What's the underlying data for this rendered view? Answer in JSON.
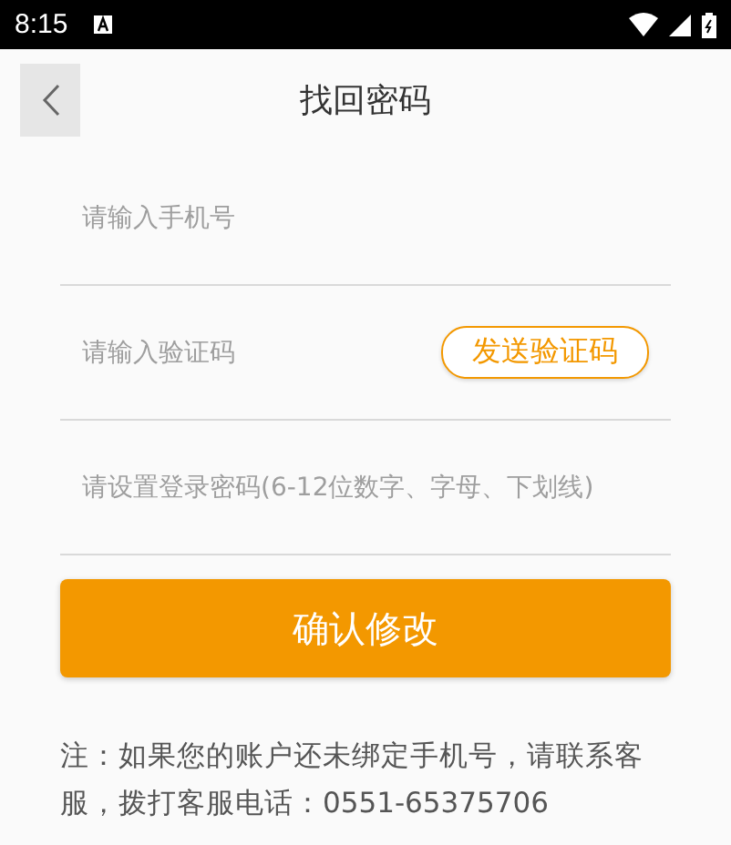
{
  "status_bar": {
    "time": "8:15"
  },
  "header": {
    "title": "找回密码"
  },
  "fields": [
    {
      "kind": "plain",
      "placeholder": "请输入手机号"
    },
    {
      "kind": "code",
      "placeholder": "请输入验证码",
      "action": "发送验证码"
    },
    {
      "kind": "plain",
      "placeholder": "请设置登录密码(6-12位数字、字母、下划线)"
    }
  ],
  "submit": "确认修改",
  "note": "注：如果您的账户还未绑定手机号，请联系客服，拨打客服电话：0551-65375706"
}
